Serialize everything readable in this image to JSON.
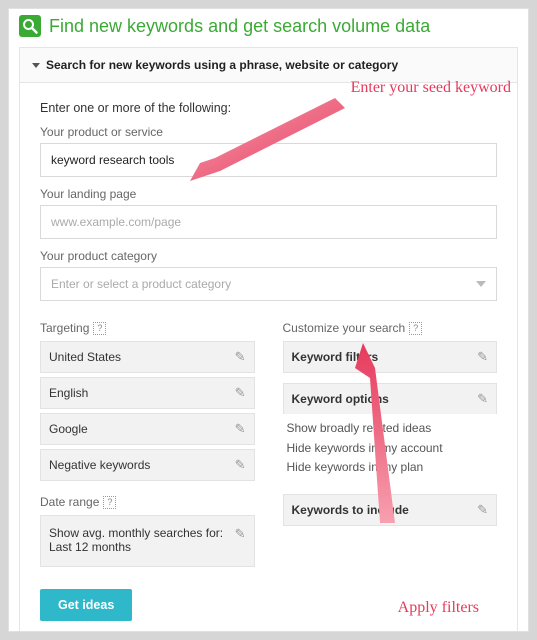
{
  "header": {
    "title": "Find new keywords and get search volume data"
  },
  "accordion": {
    "title": "Search for new keywords using a phrase, website or category"
  },
  "form": {
    "intro": "Enter one or more of the following:",
    "product_label": "Your product or service",
    "product_value": "keyword research tools",
    "landing_label": "Your landing page",
    "landing_placeholder": "www.example.com/page",
    "category_label": "Your product category",
    "category_placeholder": "Enter or select a product category"
  },
  "targeting": {
    "label": "Targeting",
    "items": [
      "United States",
      "English",
      "Google",
      "Negative keywords"
    ]
  },
  "date_range": {
    "label": "Date range",
    "value": "Show avg. monthly searches for: Last 12 months"
  },
  "customize": {
    "label": "Customize your search",
    "filters_label": "Keyword filters",
    "options_label": "Keyword options",
    "options_items": [
      "Show broadly related ideas",
      "Hide keywords in my account",
      "Hide keywords in my plan"
    ],
    "include_label": "Keywords to include"
  },
  "cta": {
    "get_ideas": "Get ideas"
  },
  "annotations": {
    "seed": "Enter your seed keyword",
    "filters": "Apply filters"
  }
}
